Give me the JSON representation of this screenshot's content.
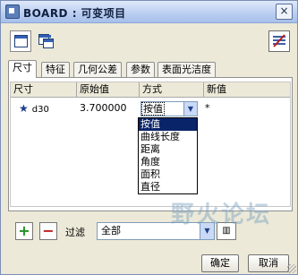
{
  "window": {
    "title": "BOARD : 可变项目"
  },
  "tabs": [
    {
      "label": "尺寸"
    },
    {
      "label": "特征"
    },
    {
      "label": "几何公差"
    },
    {
      "label": "参数"
    },
    {
      "label": "表面光洁度"
    }
  ],
  "table": {
    "columns": [
      "尺寸",
      "原始值",
      "方式",
      "新值"
    ],
    "rows": [
      {
        "name": "d30",
        "original": "3.700000",
        "mode": "按值",
        "new_value": "*"
      }
    ]
  },
  "mode_options": [
    "按值",
    "曲线长度",
    "距离",
    "角度",
    "面积",
    "直径"
  ],
  "filter": {
    "label": "过滤",
    "value": "全部"
  },
  "buttons": {
    "ok": "确定",
    "cancel": "取消"
  },
  "watermark": "野火论坛",
  "colors": {
    "selection": "#0a246a",
    "add": "#1f8f1f",
    "remove": "#c01a1a"
  }
}
